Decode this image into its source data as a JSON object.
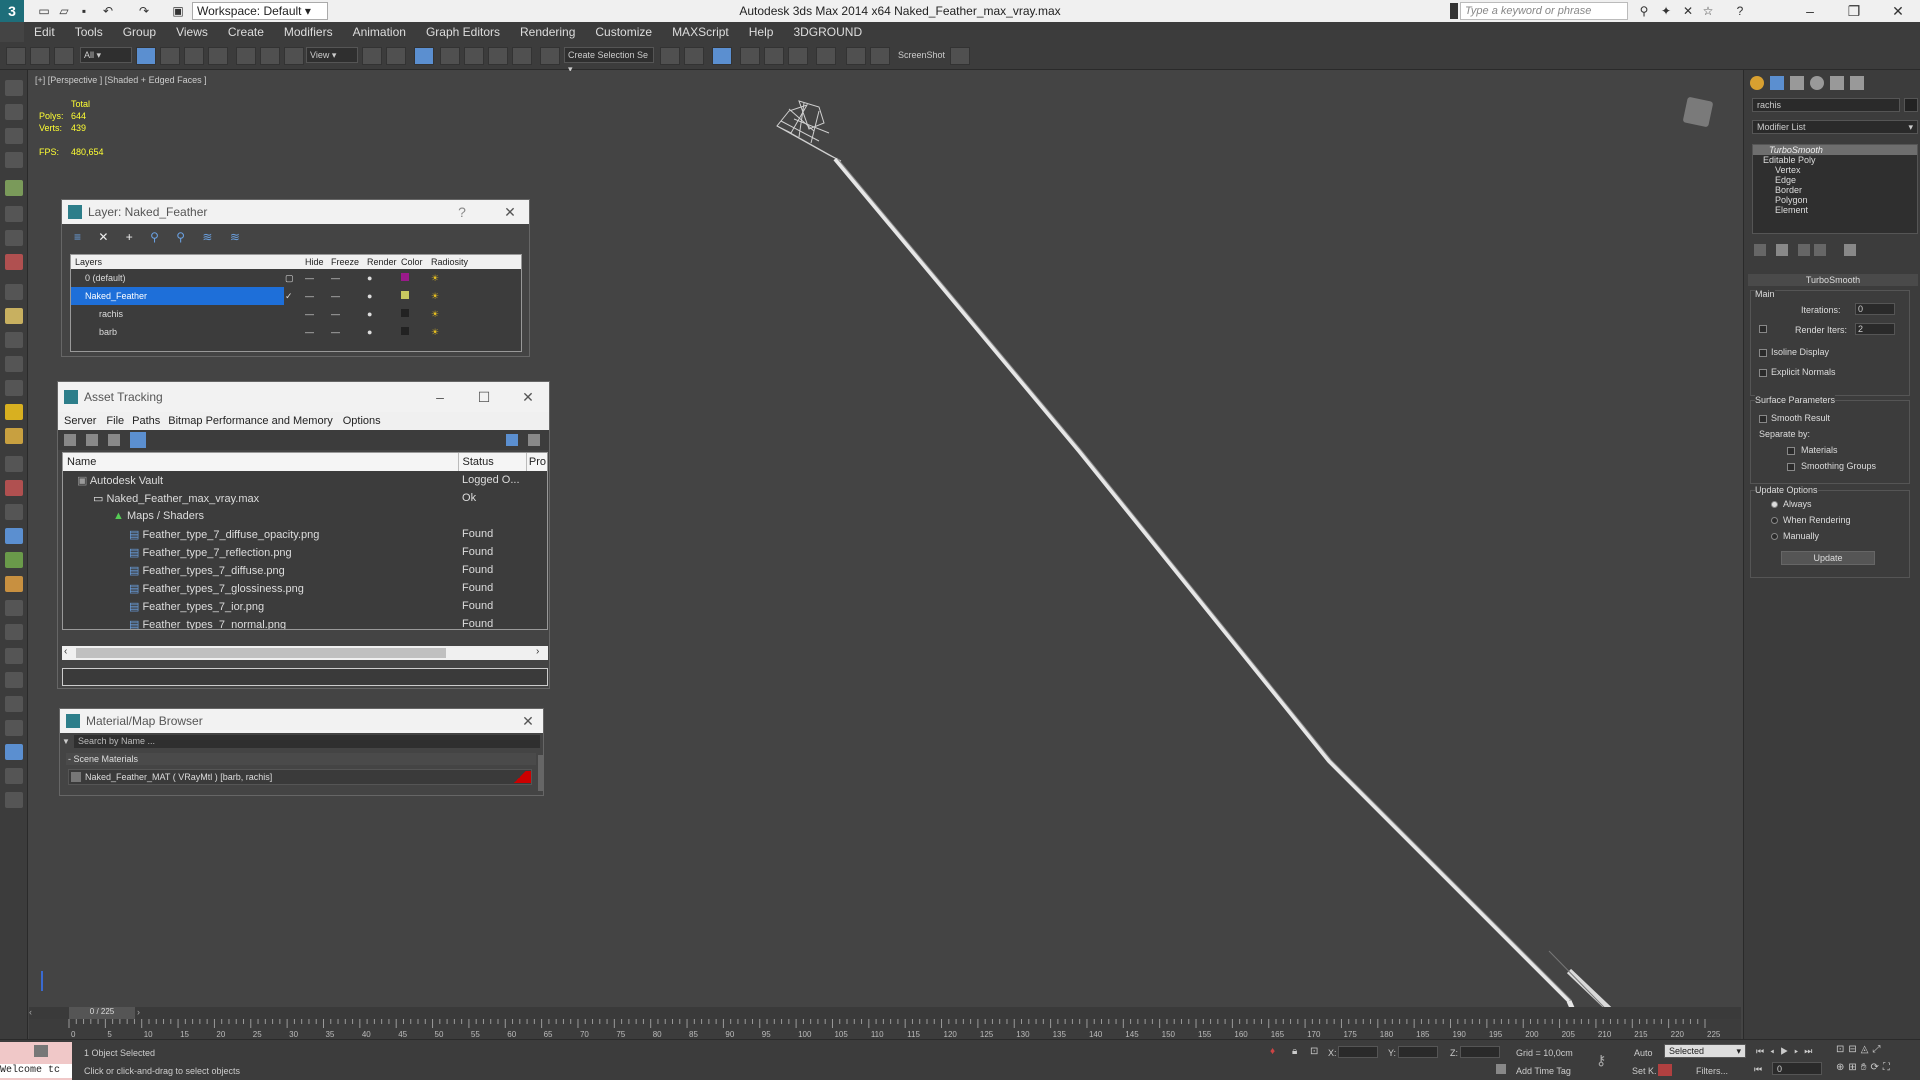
{
  "titlebar": {
    "workspace": "Workspace: Default",
    "app_title": "Autodesk 3ds Max  2014 x64     Naked_Feather_max_vray.max",
    "search_placeholder": "Type a keyword or phrase"
  },
  "menu": [
    "Edit",
    "Tools",
    "Group",
    "Views",
    "Create",
    "Modifiers",
    "Animation",
    "Graph Editors",
    "Rendering",
    "Customize",
    "MAXScript",
    "Help",
    "3DGROUND"
  ],
  "toolbar": {
    "filter": "All",
    "ref_coord": "View",
    "selection_set": "Create Selection Se",
    "screenshot": "ScreenShot"
  },
  "viewport": {
    "label": "[+] [Perspective ] [Shaded + Edged Faces ]",
    "stats": {
      "total_label": "Total",
      "polys_label": "Polys:",
      "polys": "644",
      "verts_label": "Verts:",
      "verts": "439",
      "fps_label": "FPS:",
      "fps": "480,654"
    }
  },
  "layer_dialog": {
    "title": "Layer: Naked_Feather",
    "help": "?",
    "columns": [
      "Layers",
      "Hide",
      "Freeze",
      "Render",
      "Color",
      "Radiosity"
    ],
    "rows": [
      {
        "name": "0 (default)",
        "color": "#9a1a8a",
        "indent": 1
      },
      {
        "name": "Naked_Feather",
        "color": "#c8c860",
        "indent": 1,
        "selected": true
      },
      {
        "name": "rachis",
        "color": "#222222",
        "indent": 2
      },
      {
        "name": "barb",
        "color": "#222222",
        "indent": 2
      }
    ]
  },
  "asset_tracking": {
    "title": "Asset Tracking",
    "menu": [
      "Server",
      "File",
      "Paths",
      "Bitmap Performance and Memory",
      "Options"
    ],
    "columns": [
      "Name",
      "Status",
      "Pro"
    ],
    "rows": [
      {
        "name": "Autodesk Vault",
        "status": "Logged O...",
        "indent": 1
      },
      {
        "name": "Naked_Feather_max_vray.max",
        "status": "Ok",
        "indent": 2
      },
      {
        "name": "Maps / Shaders",
        "status": "",
        "indent": 3
      },
      {
        "name": "Feather_type_7_diffuse_opacity.png",
        "status": "Found",
        "indent": 4
      },
      {
        "name": "Feather_type_7_reflection.png",
        "status": "Found",
        "indent": 4
      },
      {
        "name": "Feather_types_7_diffuse.png",
        "status": "Found",
        "indent": 4
      },
      {
        "name": "Feather_types_7_glossiness.png",
        "status": "Found",
        "indent": 4
      },
      {
        "name": "Feather_types_7_ior.png",
        "status": "Found",
        "indent": 4
      },
      {
        "name": "Feather_types_7_normal.png",
        "status": "Found",
        "indent": 4
      }
    ]
  },
  "material_browser": {
    "title": "Material/Map Browser",
    "search_placeholder": "Search by Name ...",
    "section": "- Scene Materials",
    "item": "Naked_Feather_MAT  ( VRayMtl )  [barb, rachis]"
  },
  "command_panel": {
    "object_name": "rachis",
    "modifier_list": "Modifier List",
    "stack": [
      "TurboSmooth",
      "Editable Poly",
      "Vertex",
      "Edge",
      "Border",
      "Polygon",
      "Element"
    ],
    "rollout_title": "TurboSmooth",
    "main_label": "Main",
    "iterations_label": "Iterations:",
    "iterations": "0",
    "render_iters_label": "Render Iters:",
    "render_iters": "2",
    "isoline": "Isoline Display",
    "explicit_normals": "Explicit Normals",
    "surface_params": "Surface Parameters",
    "smooth_result": "Smooth Result",
    "separate_by": "Separate by:",
    "materials": "Materials",
    "smoothing_groups": "Smoothing Groups",
    "update_options": "Update Options",
    "always": "Always",
    "when_rendering": "When Rendering",
    "manually": "Manually",
    "update_btn": "Update"
  },
  "timeline": {
    "frame": "0 / 225",
    "ticks": [
      "0",
      "5",
      "10",
      "15",
      "20",
      "25",
      "30",
      "35",
      "40",
      "45",
      "50",
      "55",
      "60",
      "65",
      "70",
      "75",
      "80",
      "85",
      "90",
      "95",
      "100",
      "105",
      "110",
      "115",
      "120",
      "125",
      "130",
      "135",
      "140",
      "145",
      "150",
      "155",
      "160",
      "165",
      "170",
      "175",
      "180",
      "185",
      "190",
      "195",
      "200",
      "205",
      "210",
      "215",
      "220",
      "225"
    ]
  },
  "statusbar": {
    "maxscript": "Welcome tc",
    "selected": "1 Object Selected",
    "prompt": "Click or click-and-drag to select objects",
    "x_label": "X:",
    "y_label": "Y:",
    "z_label": "Z:",
    "grid": "Grid = 10,0cm",
    "add_time_tag": "Add Time Tag",
    "auto": "Auto",
    "set_key": "Set K.",
    "selected_dd": "Selected",
    "filters": "Filters...",
    "frame_field": "0"
  }
}
